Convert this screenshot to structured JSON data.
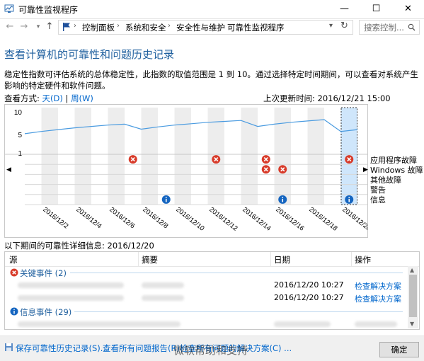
{
  "window": {
    "title": "可靠性监视程序"
  },
  "address": {
    "crumbs": [
      "控制面板",
      "系统和安全",
      "安全性与维护",
      "可靠性监视程序"
    ]
  },
  "search": {
    "placeholder": "搜索控制..."
  },
  "header": {
    "title": "查看计算机的可靠性和问题历史记录",
    "description": "稳定性指数可评估系统的总体稳定性，此指数的取值范围是 1 到 10。通过选择特定时间期间，可以查看对系统产生影响的特定硬件和软件问题。",
    "view_label": "查看方式:",
    "view_day": "天(D)",
    "view_sep": "|",
    "view_week": "周(W)",
    "updated": "上次更新时间: 2016/12/21 15:00"
  },
  "chart_data": {
    "type": "line",
    "y_ticks": [
      "10",
      "5",
      "1"
    ],
    "ylim": [
      1,
      10
    ],
    "x_labels": [
      "2016/12/2",
      "2016/12/4",
      "2016/12/6",
      "2016/12/8",
      "2016/12/10",
      "2016/12/12",
      "2016/12/14",
      "2016/12/16",
      "2016/12/18",
      "2016/12/20"
    ],
    "days": 20,
    "selected_day": 19,
    "stability_index": [
      5.2,
      5.7,
      6.1,
      6.5,
      6.8,
      7.1,
      7.3,
      6.2,
      6.7,
      7.1,
      7.4,
      7.7,
      7.9,
      8.1,
      6.8,
      7.3,
      7.7,
      8.0,
      8.3,
      5.7,
      6.1
    ],
    "rows": [
      "应用程序故障",
      "Windows 故障",
      "其他故障",
      "警告",
      "信息"
    ],
    "events": [
      {
        "day": 6,
        "row": 0,
        "type": "error"
      },
      {
        "day": 11,
        "row": 0,
        "type": "error"
      },
      {
        "day": 14,
        "row": 0,
        "type": "error"
      },
      {
        "day": 14,
        "row": 1,
        "type": "error"
      },
      {
        "day": 15,
        "row": 1,
        "type": "error"
      },
      {
        "day": 19,
        "row": 0,
        "type": "error"
      },
      {
        "day": 8,
        "row": 4,
        "type": "info"
      },
      {
        "day": 15,
        "row": 4,
        "type": "info"
      },
      {
        "day": 19,
        "row": 4,
        "type": "info"
      }
    ]
  },
  "details": {
    "header": "以下期间的可靠性详细信息: 2016/12/20",
    "columns": [
      "源",
      "摘要",
      "日期",
      "操作"
    ],
    "critical_group": "关键事件 (2)",
    "critical_rows": [
      {
        "date": "2016/12/20 10:27",
        "action": "检查解决方案"
      },
      {
        "date": "2016/12/20 10:27",
        "action": "检查解决方案"
      }
    ],
    "info_group": "信息事件 (29)"
  },
  "footer": {
    "save_link": "保存可靠性历史记录(S)...",
    "view_all_link": "查看所有问题报告(R)",
    "check_link": "检查所有问题的解决方案(C) ...",
    "ok": "确定",
    "watermark": "微软帮助和支持"
  },
  "colors": {
    "accent": "#1e5f9e",
    "line": "#4a9be0",
    "error": "#d83b2a",
    "info": "#1565c0",
    "selected": "#cfe6fb"
  }
}
